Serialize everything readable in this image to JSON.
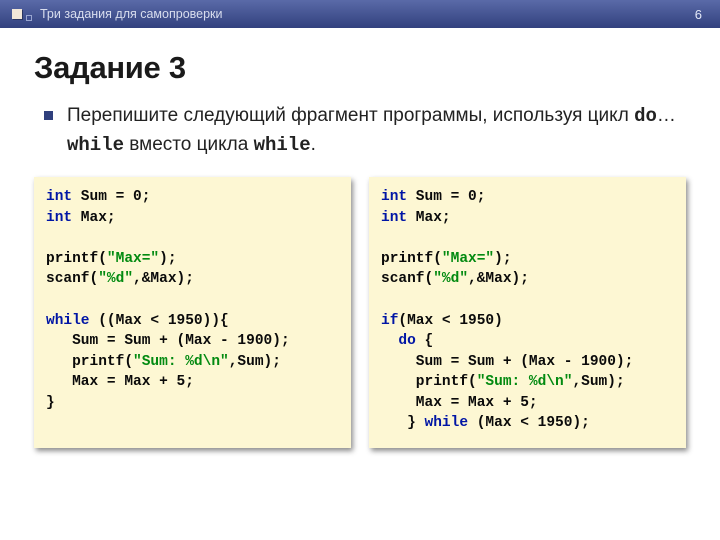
{
  "header": {
    "breadcrumb": "Три задания для самопроверки",
    "page_number": "6"
  },
  "title": "Задание 3",
  "task": {
    "prefix": "Перепишите следующий фрагмент программы, используя цикл ",
    "kw1": "do",
    "mid1": "…",
    "kw2": "while",
    "mid2": " вместо цикла ",
    "kw3": "while",
    "suffix": "."
  },
  "code_left": {
    "l1a": "int",
    "l1b": " Sum = 0;",
    "l2a": "int",
    "l2b": " Max;",
    "l3": "",
    "l4a": "printf(",
    "l4b": "\"Max=\"",
    "l4c": ");",
    "l5a": "scanf(",
    "l5b": "\"%d\"",
    "l5c": ",&Max);",
    "l6": "",
    "l7a": "while",
    "l7b": " ((Max < 1950)){",
    "l8": "   Sum = Sum + (Max - 1900);",
    "l9a": "   printf(",
    "l9b": "\"Sum: %d\\n\"",
    "l9c": ",Sum);",
    "l10": "   Max = Max + 5;",
    "l11": "}"
  },
  "code_right": {
    "l1a": "int",
    "l1b": " Sum = 0;",
    "l2a": "int",
    "l2b": " Max;",
    "l3": "",
    "l4a": "printf(",
    "l4b": "\"Max=\"",
    "l4c": ");",
    "l5a": "scanf(",
    "l5b": "\"%d\"",
    "l5c": ",&Max);",
    "l6": "",
    "l7a": "if",
    "l7b": "(Max < 1950)",
    "l8a": "  ",
    "l8b": "do",
    "l8c": " {",
    "l9": "    Sum = Sum + (Max - 1900);",
    "l10a": "    printf(",
    "l10b": "\"Sum: %d\\n\"",
    "l10c": ",Sum);",
    "l11": "    Max = Max + 5;",
    "l12a": "   } ",
    "l12b": "while",
    "l12c": " (Max < 1950);"
  }
}
